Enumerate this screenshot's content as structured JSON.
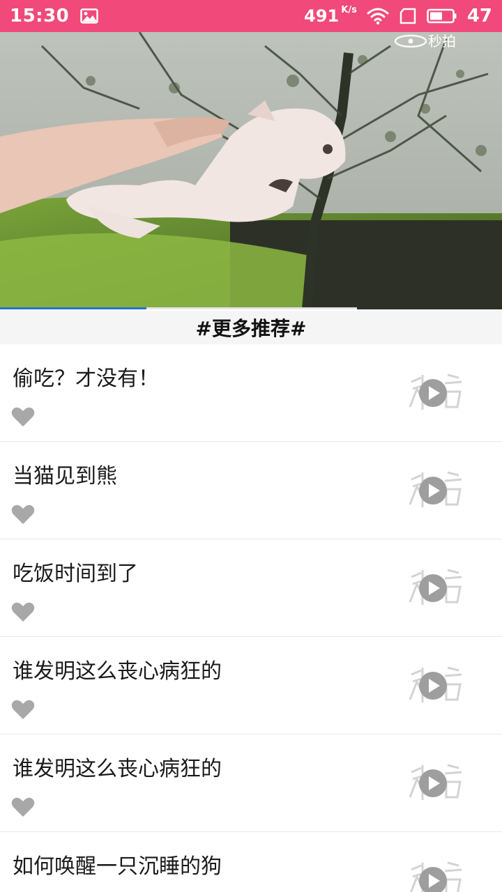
{
  "status_bar": {
    "time": "15:30",
    "net_speed": "491",
    "net_unit": "K/s",
    "battery": "47",
    "color": "#f0497a",
    "icons": [
      "image-icon",
      "wifi-icon",
      "sim-icon",
      "battery-icon"
    ]
  },
  "video": {
    "watermark": "秒拍",
    "progress_fraction": 0.41
  },
  "section": {
    "title": "#更多推荐#"
  },
  "items": [
    {
      "title": "偷吃？才没有！"
    },
    {
      "title": "当猫见到熊"
    },
    {
      "title": "吃饭时间到了"
    },
    {
      "title": "谁发明这么丧心病狂的"
    },
    {
      "title": "谁发明这么丧心病狂的"
    },
    {
      "title": "如何唤醒一只沉睡的狗"
    }
  ]
}
